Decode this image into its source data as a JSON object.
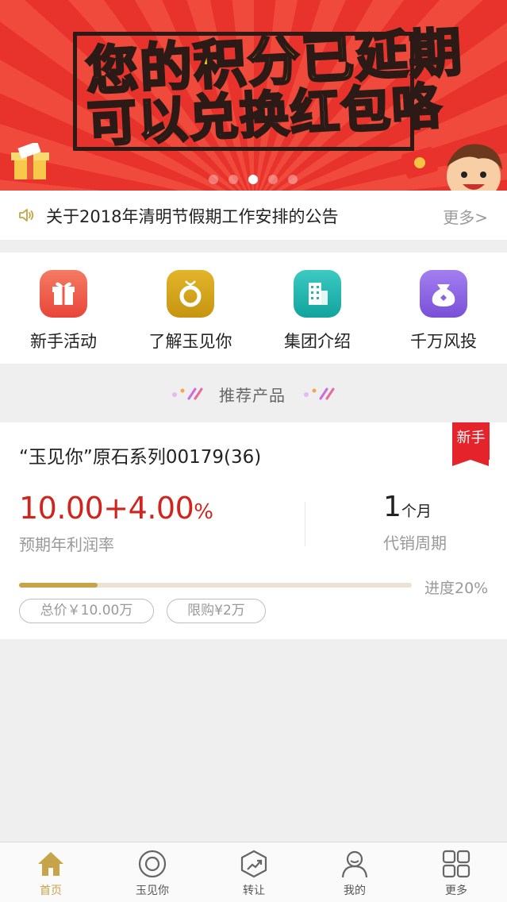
{
  "banner": {
    "line1": "您的积分已延期",
    "line2": "可以兑换红包咯",
    "dots_count": 5,
    "active_dot": 2
  },
  "notice": {
    "icon": "speaker-icon",
    "text": "关于2018年清明节假期工作安排的公告",
    "more": "更多>"
  },
  "quick_menu": [
    {
      "label": "新手活动",
      "icon": "gift-icon",
      "color": "#ef5a4a"
    },
    {
      "label": "了解玉见你",
      "icon": "jade-disc-icon",
      "color": "#d5a520"
    },
    {
      "label": "集团介绍",
      "icon": "building-icon",
      "color": "#1fb6b0"
    },
    {
      "label": "千万风投",
      "icon": "money-bag-icon",
      "color": "#8b62e0"
    }
  ],
  "section": {
    "title": "推荐产品"
  },
  "product": {
    "title": "“玉见你”原石系列00179(36)",
    "badge": "新手",
    "rate_base": "10.00",
    "rate_plus": "+4.00",
    "rate_pct": "%",
    "rate_label": "预期年利润率",
    "period_value": "1",
    "period_unit": "个月",
    "period_label": "代销周期",
    "progress_value": 0.2,
    "progress_text": "进度20%",
    "tag_total": "总价￥10.00万",
    "tag_limit": "限购¥2万"
  },
  "tabbar": {
    "items": [
      {
        "label": "首页",
        "icon": "home-icon",
        "active": true
      },
      {
        "label": "玉见你",
        "icon": "jade-icon",
        "active": false
      },
      {
        "label": "转让",
        "icon": "transfer-icon",
        "active": false
      },
      {
        "label": "我的",
        "icon": "user-icon",
        "active": false
      },
      {
        "label": "更多",
        "icon": "grid-icon",
        "active": false
      }
    ],
    "active_color": "#c7a44a"
  }
}
